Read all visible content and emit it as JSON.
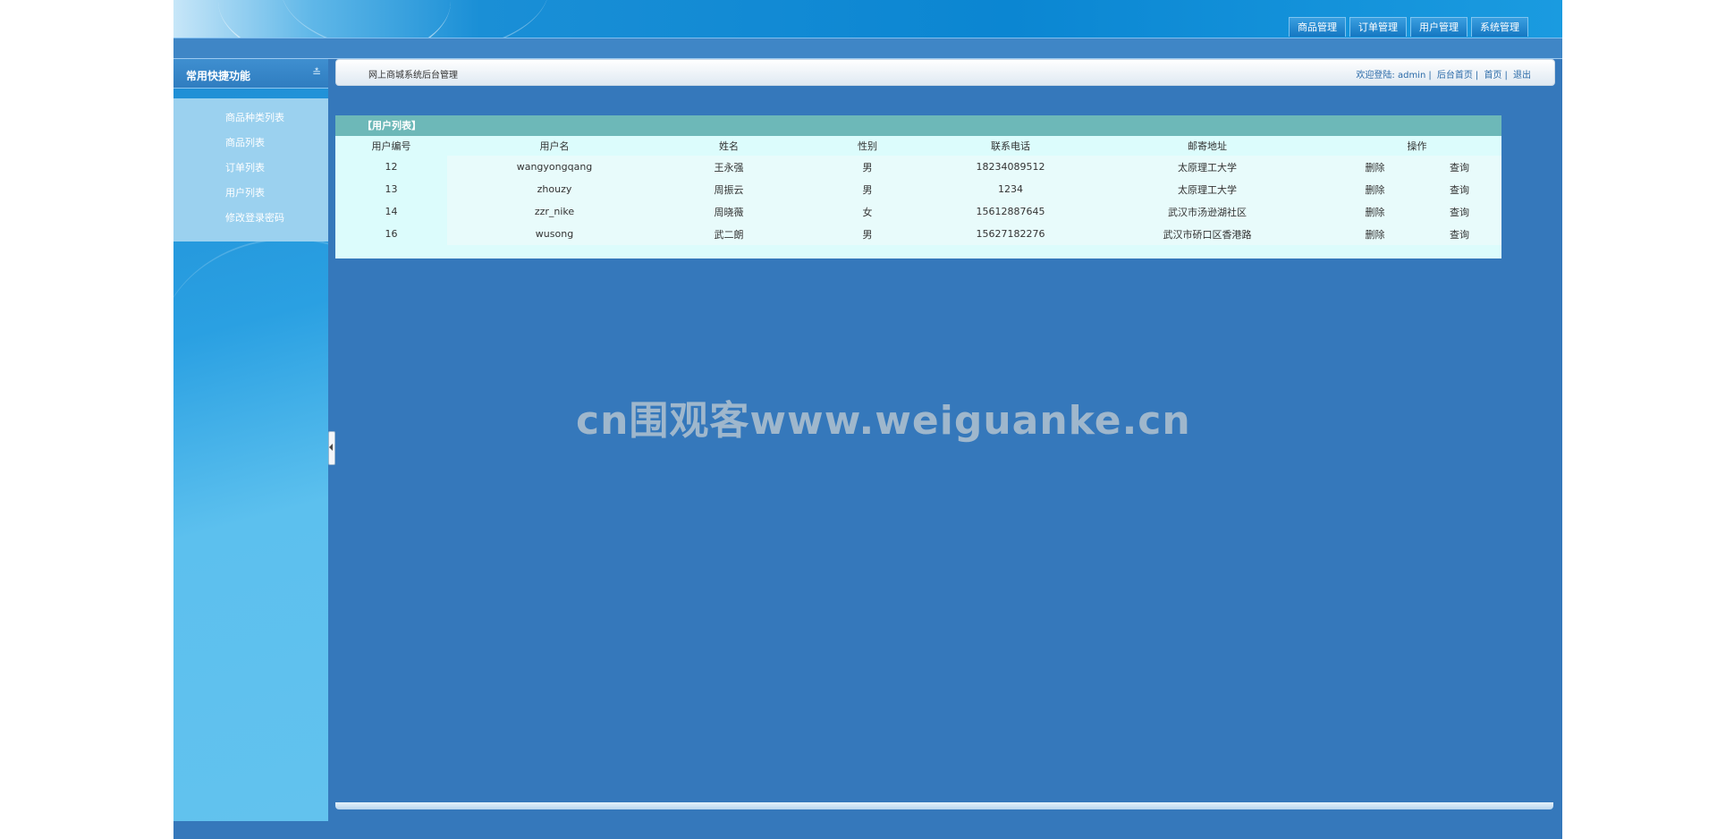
{
  "header": {
    "nav": [
      "商品管理",
      "订单管理",
      "用户管理",
      "系统管理"
    ]
  },
  "sidebar": {
    "title": "常用快捷功能",
    "collapse_icon": "double-chevron-down-icon",
    "items": [
      "商品种类列表",
      "商品列表",
      "订单列表",
      "用户列表",
      "修改登录密码"
    ]
  },
  "content": {
    "title": "网上商城系统后台管理",
    "welcome": "欢迎登陆:",
    "username": "admin",
    "links": [
      "后台首页",
      "首页",
      "退出"
    ]
  },
  "user_list": {
    "title": "【用户列表】",
    "columns": [
      "用户编号",
      "用户名",
      "姓名",
      "性别",
      "联系电话",
      "邮寄地址",
      "操作"
    ],
    "rows": [
      {
        "id": "12",
        "username": "wangyongqang",
        "name": "王永强",
        "gender": "男",
        "phone": "18234089512",
        "address": "太原理工大学",
        "delete": "删除",
        "query": "查询"
      },
      {
        "id": "13",
        "username": "zhouzy",
        "name": "周振云",
        "gender": "男",
        "phone": "1234",
        "address": "太原理工大学",
        "delete": "删除",
        "query": "查询"
      },
      {
        "id": "14",
        "username": "zzr_nike",
        "name": "周晓薇",
        "gender": "女",
        "phone": "15612887645",
        "address": "武汉市汤逊湖社区",
        "delete": "删除",
        "query": "查询"
      },
      {
        "id": "16",
        "username": "wusong",
        "name": "武二朗",
        "gender": "男",
        "phone": "15627182276",
        "address": "武汉市硚口区香港路",
        "delete": "删除",
        "query": "查询"
      }
    ]
  },
  "watermark": "cn围观客www.weiguanke.cn",
  "colors": {
    "frame": "#3578bb",
    "panel_head": "#6db8b8",
    "panel_bg": "#dcfcfc",
    "sidebar_menu": "#9bd1ef"
  }
}
